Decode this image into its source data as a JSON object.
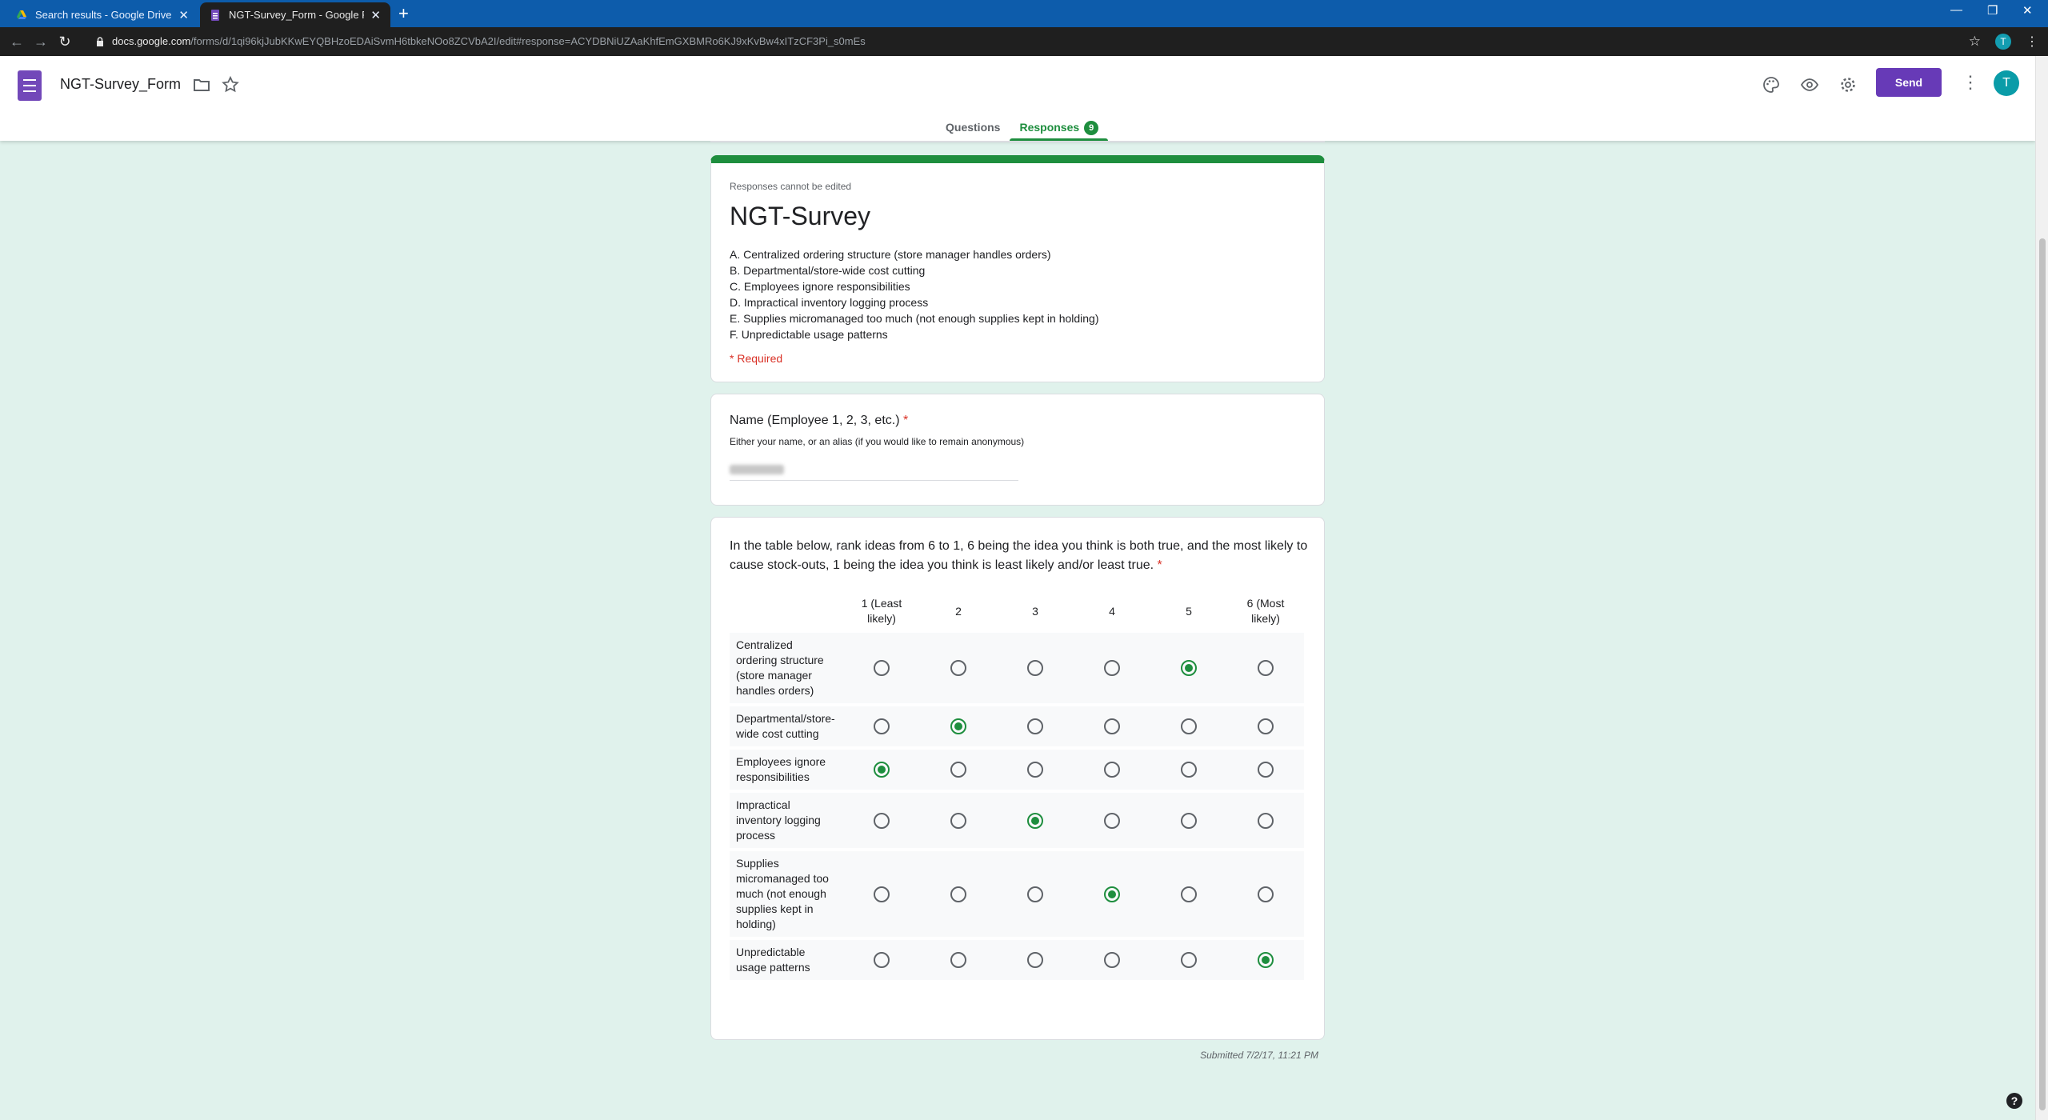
{
  "browser": {
    "tabs": [
      {
        "title": "Search results - Google Drive",
        "active": false
      },
      {
        "title": "NGT-Survey_Form - Google Form",
        "active": true
      }
    ],
    "url_host": "docs.google.com",
    "url_path": "/forms/d/1qi96kjJubKKwEYQBHzoEDAiSvmH6tbkeNOo8ZCVbA2I/edit#response=ACYDBNiUZAaKhfEmGXBMRo6KJ9xKvBw4xITzCF3Pi_s0mEs",
    "profile_initial": "T"
  },
  "header": {
    "doc_title": "NGT-Survey_Form",
    "send_label": "Send",
    "avatar_initial": "T",
    "tabs": [
      {
        "label": "Questions",
        "active": false
      },
      {
        "label": "Responses",
        "active": true,
        "badge": "9"
      }
    ]
  },
  "form": {
    "readonly_note": "Responses cannot be edited",
    "title": "NGT-Survey",
    "description": [
      "A. Centralized ordering structure (store manager handles orders)",
      "B. Departmental/store-wide cost cutting",
      "C. Employees ignore responsibilities",
      "D. Impractical inventory logging process",
      "E. Supplies micromanaged too much (not enough supplies kept in holding)",
      "F. Unpredictable usage patterns"
    ],
    "required_note": "* Required"
  },
  "q1": {
    "title": "Name (Employee 1, 2, 3, etc.)",
    "required_mark": "*",
    "help": "Either your name, or an alias (if you would like to remain anonymous)"
  },
  "q2": {
    "title": "In the table below, rank ideas from 6 to 1, 6 being the idea you think is both true, and the most likely to cause stock-outs, 1 being the idea you think is least likely and/or least true.",
    "required_mark": "*",
    "columns": [
      "1 (Least likely)",
      "2",
      "3",
      "4",
      "5",
      "6 (Most likely)"
    ],
    "rows": [
      {
        "label": "Centralized ordering structure (store manager handles orders)",
        "selected": 5
      },
      {
        "label": "Departmental/store-wide cost cutting",
        "selected": 2
      },
      {
        "label": "Employees ignore responsibilities",
        "selected": 1
      },
      {
        "label": "Impractical inventory logging process",
        "selected": 3
      },
      {
        "label": "Supplies micromanaged too much (not enough supplies kept in holding)",
        "selected": 4
      },
      {
        "label": "Unpredictable usage patterns",
        "selected": 6
      }
    ]
  },
  "submitted": "Submitted 7/2/17, 11:21 PM",
  "colors": {
    "accent": "#1e8e3e",
    "brand": "#673ab7",
    "background": "#e0f2ec"
  }
}
